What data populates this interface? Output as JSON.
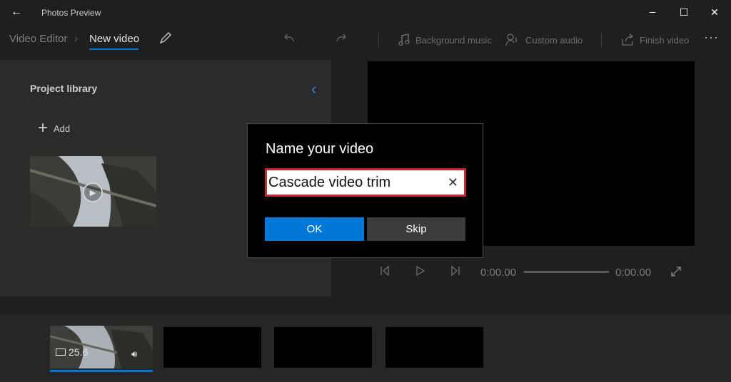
{
  "window": {
    "title": "Photos Preview",
    "back_glyph": "←",
    "minimize_glyph": "─",
    "maximize_glyph": "☐",
    "close_glyph": "✕"
  },
  "breadcrumb": {
    "parent": "Video Editor",
    "current": "New video"
  },
  "commands": {
    "background_music": "Background music",
    "custom_audio": "Custom audio",
    "finish_video": "Finish video",
    "more": "···"
  },
  "library": {
    "title": "Project library",
    "add_label": "Add"
  },
  "transport": {
    "current_time": "0:00.00",
    "end_time": "0:00.00"
  },
  "storyboard": {
    "clip_duration": "25.6"
  },
  "dialog": {
    "title": "Name your video",
    "input_value": "Cascade video trim",
    "clear_glyph": "✕",
    "ok_label": "OK",
    "skip_label": "Skip"
  },
  "colors": {
    "accent": "#0078d7",
    "highlight_border": "#c4262e",
    "background": "#1f1f1f"
  }
}
